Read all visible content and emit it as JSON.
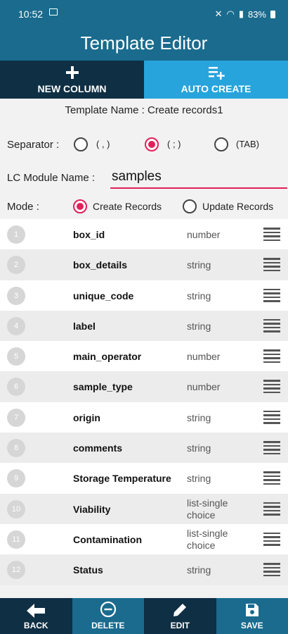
{
  "status_bar": {
    "time": "10:52",
    "battery": "83%"
  },
  "header": {
    "title": "Template Editor"
  },
  "tabs": {
    "new_column": "NEW COLUMN",
    "auto_create": "AUTO CREATE"
  },
  "template": {
    "name_text": "Template Name : Create records1"
  },
  "separator": {
    "label": "Separator :",
    "options": [
      {
        "label": "( , )",
        "selected": false
      },
      {
        "label": "( ; )",
        "selected": true
      },
      {
        "label": "(TAB)",
        "selected": false
      }
    ]
  },
  "module": {
    "label": "LC Module Name :",
    "value": "samples"
  },
  "mode": {
    "label": "Mode :",
    "options": [
      {
        "label": "Create Records",
        "selected": true
      },
      {
        "label": "Update Records",
        "selected": false
      }
    ]
  },
  "columns": [
    {
      "num": "1",
      "name": "box_id",
      "type": "number"
    },
    {
      "num": "2",
      "name": "box_details",
      "type": "string"
    },
    {
      "num": "3",
      "name": "unique_code",
      "type": "string"
    },
    {
      "num": "4",
      "name": "label",
      "type": "string"
    },
    {
      "num": "5",
      "name": "main_operator",
      "type": "number"
    },
    {
      "num": "6",
      "name": "sample_type",
      "type": "number"
    },
    {
      "num": "7",
      "name": "origin",
      "type": "string"
    },
    {
      "num": "8",
      "name": "comments",
      "type": "string"
    },
    {
      "num": "9",
      "name": "Storage Temperature",
      "type": "string"
    },
    {
      "num": "10",
      "name": "Viability",
      "type": "list-single choice"
    },
    {
      "num": "11",
      "name": "Contamination",
      "type": "list-single choice"
    },
    {
      "num": "12",
      "name": "Status",
      "type": "string"
    }
  ],
  "bottom_bar": {
    "back": "BACK",
    "delete": "DELETE",
    "edit": "EDIT",
    "save": "SAVE"
  },
  "colors": {
    "header": "#1a6b8e",
    "dark": "#0f2f44",
    "accent_tab": "#27a4dc",
    "radio_selected": "#e0215a"
  }
}
